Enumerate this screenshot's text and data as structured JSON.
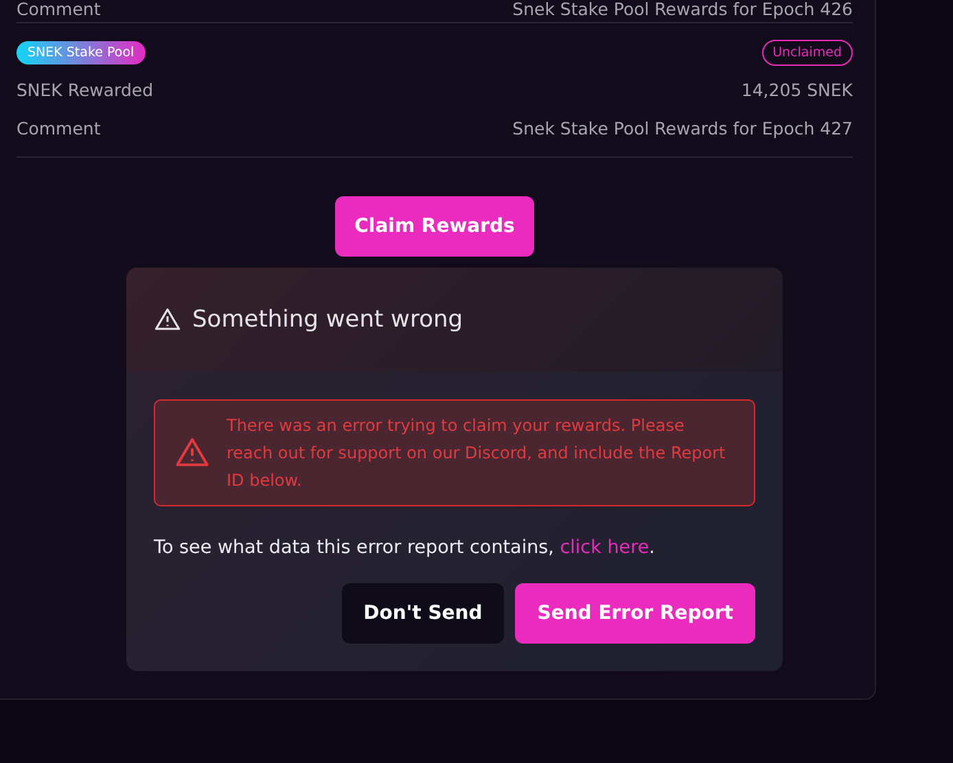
{
  "rewards": [
    {
      "rows": [
        {
          "label": "Comment",
          "value": "Snek Stake Pool Rewards for Epoch 426"
        }
      ]
    },
    {
      "pool": "SNEK Stake Pool",
      "status": "Unclaimed",
      "rows": [
        {
          "label": "SNEK Rewarded",
          "value": "14,205 SNEK"
        },
        {
          "label": "Comment",
          "value": "Snek Stake Pool Rewards for Epoch 427"
        }
      ]
    }
  ],
  "claim_button": "Claim Rewards",
  "dialog": {
    "title": "Something went wrong",
    "alert": "There was an error trying to claim your rewards. Please reach out for support on our Discord, and include the Report ID below.",
    "info": "To see what data this error report contains, ",
    "link": "click here",
    "info_end": ".",
    "buttons": [
      {
        "label": "Don't Send",
        "kind": "secondary"
      },
      {
        "label": "Send Error Report",
        "kind": "primary"
      }
    ]
  }
}
